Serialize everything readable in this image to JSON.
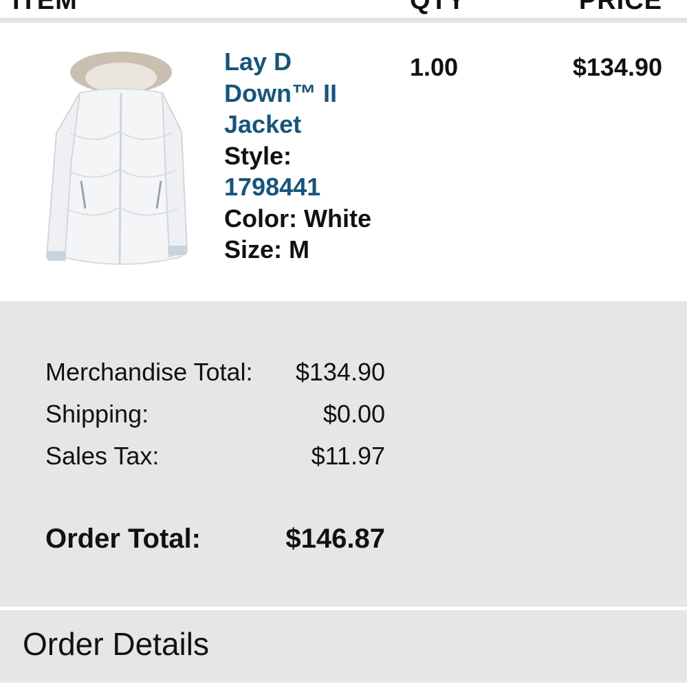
{
  "table": {
    "headers": {
      "item": "ITEM",
      "qty": "QTY",
      "price": "PRICE"
    }
  },
  "item": {
    "name_line1": "Lay D",
    "name_line2": "Down™ II",
    "name_line3": "Jacket",
    "style_label": "Style:",
    "style_value": "1798441",
    "color": "Color: White",
    "size": "Size: M",
    "qty": "1.00",
    "price": "$134.90",
    "image_icon": "white-puffer-jacket-image"
  },
  "summary": {
    "merch_label": "Merchandise Total:",
    "merch_value": "$134.90",
    "shipping_label": "Shipping:",
    "shipping_value": "$0.00",
    "tax_label": "Sales Tax:",
    "tax_value": "$11.97",
    "total_label": "Order Total:",
    "total_value": "$146.87"
  },
  "order_details": {
    "title": "Order Details"
  },
  "colors": {
    "link": "#17557a",
    "summary_bg": "#e6e6e6",
    "text": "#111111"
  }
}
